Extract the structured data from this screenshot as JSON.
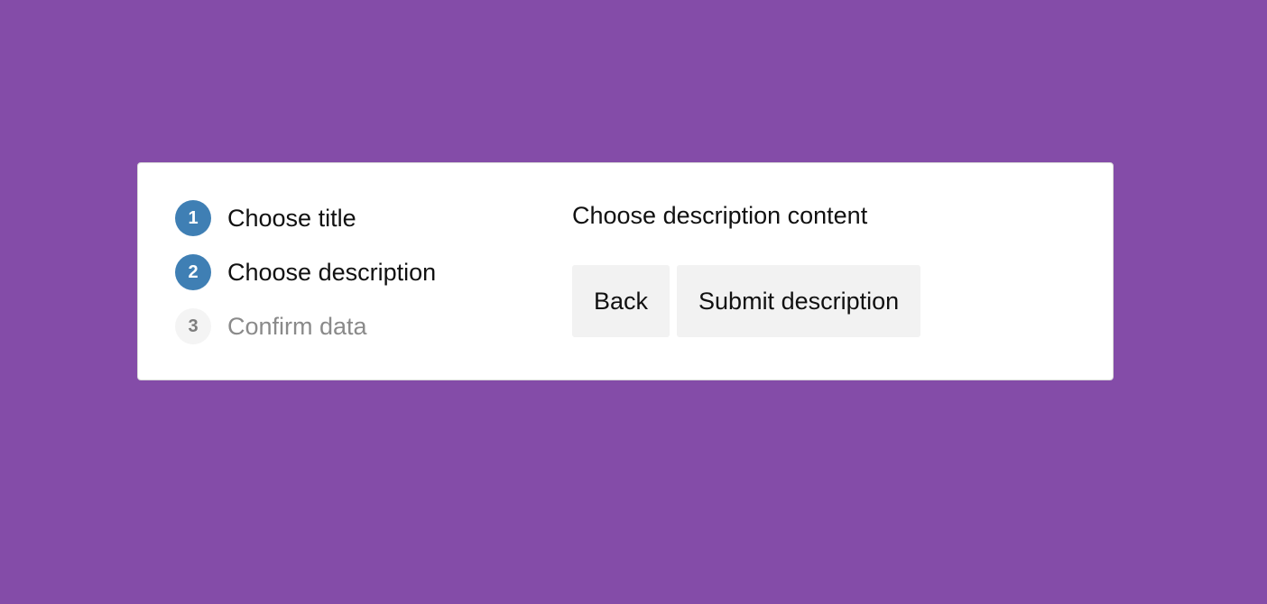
{
  "colors": {
    "background": "#844ca8",
    "card": "#ffffff",
    "step_done": "#3f7fb4",
    "step_pending": "#f4f4f4",
    "button": "#f2f2f2"
  },
  "wizard": {
    "steps": [
      {
        "number": "1",
        "label": "Choose title",
        "state": "completed"
      },
      {
        "number": "2",
        "label": "Choose description",
        "state": "active"
      },
      {
        "number": "3",
        "label": "Confirm data",
        "state": "pending"
      }
    ],
    "content": {
      "heading": "Choose description content",
      "back_label": "Back",
      "submit_label": "Submit description"
    }
  }
}
